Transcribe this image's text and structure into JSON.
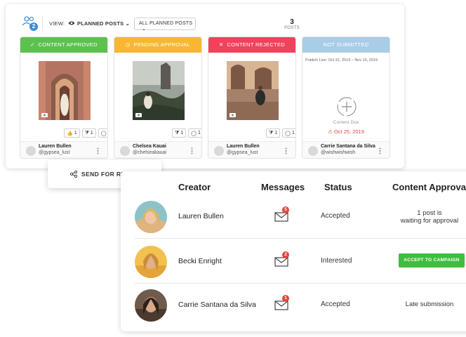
{
  "toolbar": {
    "users_badge": "2",
    "view_label": "VIEW:",
    "view_value": "PLANNED POSTS",
    "filter_value": "ALL PLANNED POSTS",
    "posts_count": "3",
    "posts_label": "POSTS"
  },
  "cards": [
    {
      "status": "CONTENT APPROVED",
      "color": "#5cc14f",
      "name": "Lauren Bullen",
      "handle": "@gypsea_lust",
      "likes": "1",
      "dislikes": "1",
      "comments": "2"
    },
    {
      "status": "PENDING APPROVAL",
      "color": "#f7b733",
      "name": "Chelsea Kauai",
      "handle": "@chelseakauai",
      "dislikes": "1",
      "comments": "1"
    },
    {
      "status": "CONTENT REJECTED",
      "color": "#f2415a",
      "name": "Lauren Bullen",
      "handle": "@gypsea_lust",
      "dislikes": "1",
      "comments": "1"
    },
    {
      "status": "NOT SUBMITTED",
      "color": "#a8cde8",
      "name": "Carrie Santana da Silva",
      "handle": "@wishwishwish",
      "publish_live": "Publish Live: Oct 31, 2019 – Nov 15, 2019",
      "due_label": "Content Due",
      "due_date": "Oct 25, 2019"
    }
  ],
  "send_review_label": "SEND FOR REVIEW",
  "table": {
    "headers": {
      "creator": "Creator",
      "messages": "Messages",
      "status": "Status",
      "approval": "Content Approva"
    },
    "rows": [
      {
        "creator": "Lauren Bullen",
        "messages": "5",
        "status": "Accepted",
        "approval_line1": "1 post is",
        "approval_line2": "waiting for approval"
      },
      {
        "creator": "Becki Enright",
        "messages": "2",
        "status": "Interested",
        "approval_button": "ACCEPT TO CAMPAIGN"
      },
      {
        "creator": "Carrie Santana da Silva",
        "messages": "1",
        "status": "Accepted",
        "approval_text": "Late submission"
      }
    ]
  },
  "icons": [
    "users-icon",
    "eye-icon",
    "chevron-down-icon",
    "check-icon",
    "clock-icon",
    "close-icon",
    "camera-icon",
    "like-icon",
    "dislike-icon",
    "comment-icon",
    "kebab-icon",
    "plus-circle-icon",
    "warning-icon",
    "share-icon",
    "cursor-icon",
    "envelope-icon"
  ]
}
